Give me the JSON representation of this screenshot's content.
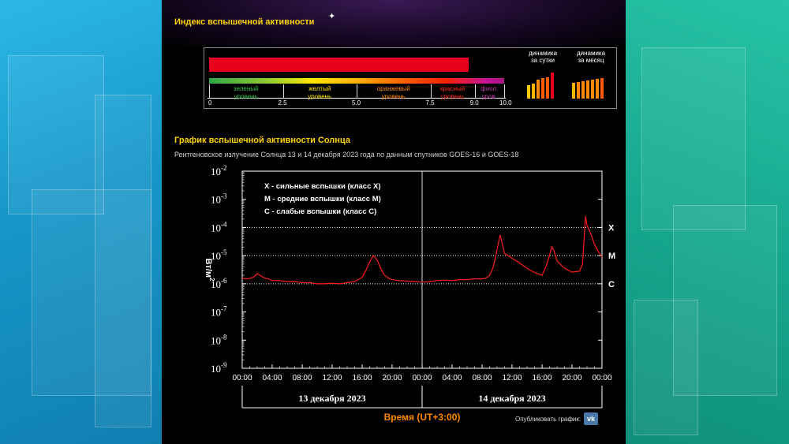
{
  "panel": {
    "index_title": "Индекс вспышечной активности",
    "chart_title": "График вспышечной активности Солнца",
    "subtitle": "Рентгеновское излучение Солнца 13 и 14 декабря 2023 года по данным спутников GOES-16 и GOES-18"
  },
  "index": {
    "current_value": 8.8,
    "scale_min": 0,
    "scale_max": 10,
    "scale_ticks": [
      "0",
      "2.5",
      "5.0",
      "7.5",
      "9.0",
      "10.0"
    ],
    "levels": [
      {
        "label": "зеленый уровень",
        "line1": "зеленый",
        "line2": "уровень",
        "color": "#2fbf4a",
        "from": 0,
        "to": 2.5
      },
      {
        "label": "желтый уровень",
        "line1": "желтый",
        "line2": "уровень",
        "color": "#ffe600",
        "from": 2.5,
        "to": 5.0
      },
      {
        "label": "оранжевый уровень",
        "line1": "оранжевый",
        "line2": "уровень",
        "color": "#ff8a00",
        "from": 5.0,
        "to": 7.5
      },
      {
        "label": "красный уровень",
        "line1": "красный",
        "line2": "уровень",
        "color": "#ff2a1a",
        "from": 7.5,
        "to": 9.0
      },
      {
        "label": "фиол. уров.",
        "line1": "фиол.",
        "line2": "уров.",
        "color": "#c03aa8",
        "from": 9.0,
        "to": 10.0
      }
    ],
    "bar_color": "#e8001c",
    "dynamics_day": {
      "title1": "динамика",
      "title2": "за сутки",
      "values": [
        4.0,
        4.6,
        5.6,
        6.1,
        6.5,
        7.8
      ]
    },
    "dynamics_month": {
      "title1": "динамика",
      "title2": "за месяц",
      "values": [
        4.7,
        5.0,
        5.2,
        5.4,
        5.6,
        5.9,
        6.2
      ]
    }
  },
  "chart_data": {
    "type": "line",
    "series": [
      {
        "color": "#ff1a1a"
      }
    ],
    "ylabel": "Вт/м",
    "ylabel_sup": "2",
    "yscale": "log",
    "ylim": [
      1e-09,
      0.01
    ],
    "ytick_exponents": [
      -2,
      -3,
      -4,
      -5,
      -6,
      -7,
      -8,
      -9
    ],
    "xlim_hours": [
      0,
      48
    ],
    "xtick_labels": [
      "00:00",
      "04:00",
      "08:00",
      "12:00",
      "16:00",
      "20:00",
      "00:00",
      "04:00",
      "08:00",
      "12:00",
      "16:00",
      "20:00",
      "00:00"
    ],
    "day_labels": [
      "13 декабря 2023",
      "14 декабря 2023"
    ],
    "xlabel": "Время (UT+3:00)",
    "class_lines": [
      {
        "label": "X",
        "value": 0.0001
      },
      {
        "label": "M",
        "value": 1e-05
      },
      {
        "label": "C",
        "value": 1e-06
      }
    ],
    "legend": [
      "X - сильные вспышки (класс X)",
      "M - средние вспышки (класс M)",
      "C - слабые вспышки (класс C)"
    ],
    "x": [
      0,
      0.5,
      1,
      1.5,
      2,
      2.5,
      3,
      3.5,
      4,
      5,
      6,
      7,
      8,
      9,
      10,
      11,
      12,
      13,
      14,
      15,
      16,
      16.5,
      17,
      17.5,
      18,
      18.3,
      18.6,
      19,
      19.5,
      20,
      21,
      22,
      23,
      24,
      25,
      26,
      27,
      28,
      29,
      30,
      31,
      32,
      32.5,
      33,
      33.5,
      34,
      34.4,
      34.8,
      35,
      36,
      37,
      38,
      39,
      40,
      40.5,
      41,
      41.3,
      41.6,
      42,
      43,
      44,
      45,
      45.4,
      45.8,
      46,
      46.5,
      47,
      47.5,
      48
    ],
    "y": [
      1.6e-06,
      1.5e-06,
      1.55e-06,
      1.7e-06,
      2.3e-06,
      1.9e-06,
      1.6e-06,
      1.5e-06,
      1.3e-06,
      1.3e-06,
      1.2e-06,
      1.2e-06,
      1.1e-06,
      1.1e-06,
      1e-06,
      1e-06,
      1.05e-06,
      1e-06,
      1.1e-06,
      1.2e-06,
      1.7e-06,
      3e-06,
      6e-06,
      1e-05,
      7e-06,
      4.5e-06,
      3e-06,
      2e-06,
      1.6e-06,
      1.4e-06,
      1.3e-06,
      1.25e-06,
      1.2e-06,
      1.15e-06,
      1.2e-06,
      1.3e-06,
      1.35e-06,
      1.3e-06,
      1.4e-06,
      1.4e-06,
      1.5e-06,
      1.5e-06,
      1.6e-06,
      2e-06,
      4e-06,
      1.6e-05,
      5.5e-05,
      2e-05,
      1.2e-05,
      8e-06,
      5.5e-06,
      3.5e-06,
      2.5e-06,
      2e-06,
      4e-06,
      1e-05,
      2.1e-05,
      1.5e-05,
      6.5e-06,
      3.5e-06,
      2.6e-06,
      2.8e-06,
      5e-06,
      0.00025,
      0.00012,
      6e-05,
      2.5e-05,
      1.4e-05,
      9e-06,
      6e-06,
      4.5e-06
    ]
  },
  "footer": {
    "publish_label": "Опубликовать график:",
    "vk_label": "vk"
  }
}
